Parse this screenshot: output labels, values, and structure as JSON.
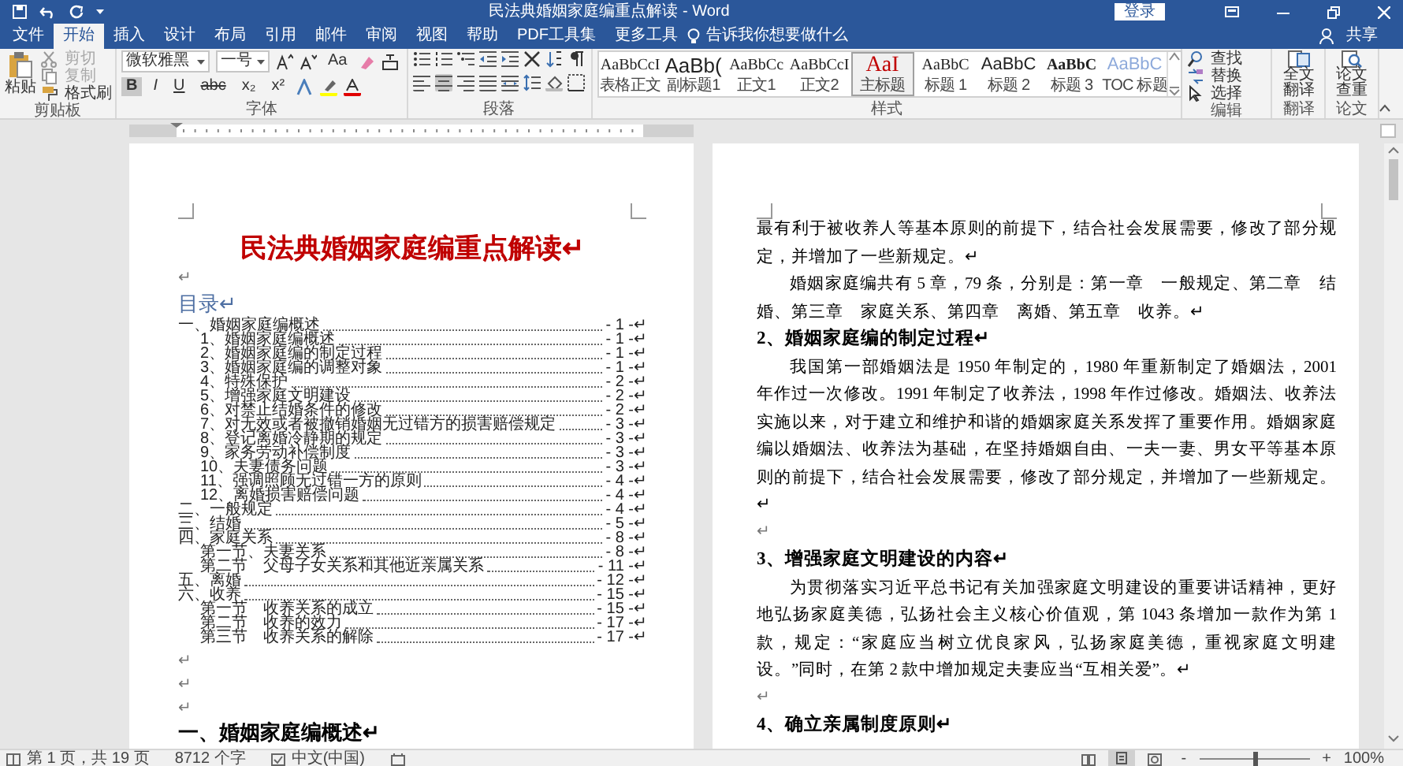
{
  "title_bar": {
    "title": "民法典婚姻家庭编重点解读 - Word",
    "sign_in": "登录"
  },
  "tabs": [
    {
      "label": "文件",
      "selected": false
    },
    {
      "label": "开始",
      "selected": true
    },
    {
      "label": "插入",
      "selected": false
    },
    {
      "label": "设计",
      "selected": false
    },
    {
      "label": "布局",
      "selected": false
    },
    {
      "label": "引用",
      "selected": false
    },
    {
      "label": "邮件",
      "selected": false
    },
    {
      "label": "审阅",
      "selected": false
    },
    {
      "label": "视图",
      "selected": false
    },
    {
      "label": "帮助",
      "selected": false
    },
    {
      "label": "PDF工具集",
      "selected": false
    },
    {
      "label": "更多工具",
      "selected": false
    }
  ],
  "tell_me": "告诉我你想要做什么",
  "share": "共享",
  "ribbon": {
    "clipboard": {
      "label": "剪贴板",
      "paste": "粘贴",
      "items": [
        {
          "label": "剪切",
          "disabled": true
        },
        {
          "label": "复制",
          "disabled": true
        },
        {
          "label": "格式刷",
          "disabled": false
        }
      ]
    },
    "font": {
      "label": "字体",
      "name": "微软雅黑",
      "size": "一号",
      "case_button": "Aa",
      "buttons": [
        {
          "text": "B",
          "selected": true
        },
        {
          "text": "I",
          "selected": false
        },
        {
          "text": "U",
          "selected": false
        },
        {
          "text": "abc",
          "selected": false
        },
        {
          "text": "x₂",
          "selected": false
        },
        {
          "text": "x²",
          "selected": false
        }
      ]
    },
    "paragraph": {
      "label": "段落",
      "align": [
        {
          "selected": false
        },
        {
          "selected": true
        },
        {
          "selected": false
        },
        {
          "selected": false
        },
        {
          "selected": false
        }
      ]
    },
    "styles": {
      "label": "样式",
      "items": [
        {
          "preview": "AaBbCcI",
          "name": "表格正文",
          "kind": "plain",
          "selected": false
        },
        {
          "preview": "AaBb(",
          "name": "副标题1",
          "kind": "large",
          "selected": false
        },
        {
          "preview": "AaBbCc",
          "name": "正文1",
          "kind": "serif",
          "selected": false
        },
        {
          "preview": "AaBbCcI",
          "name": "正文2",
          "kind": "plain",
          "selected": false
        },
        {
          "preview": "AaI",
          "name": "主标题",
          "kind": "red",
          "selected": true
        },
        {
          "preview": "AaBbC",
          "name": "标题 1",
          "kind": "serif",
          "selected": false
        },
        {
          "preview": "AaBbC",
          "name": "标题 2",
          "kind": "medium",
          "selected": false
        },
        {
          "preview": "AaBbC",
          "name": "标题 3",
          "kind": "bold",
          "selected": false
        },
        {
          "preview": "AaBbC",
          "name": "TOC 标题",
          "kind": "toc",
          "selected": false
        }
      ]
    },
    "editing": {
      "label": "编辑",
      "items": [
        "查找",
        "替换",
        "选择"
      ]
    },
    "translate": {
      "label": "翻译",
      "button": "全文翻译"
    },
    "paper": {
      "label": "论文",
      "button": "论文查重"
    }
  },
  "left_page": [
    {
      "kind": "title",
      "text": "民法典婚姻家庭编重点解读↵"
    },
    {
      "kind": "blank",
      "text": "↵"
    },
    {
      "kind": "toc_heading",
      "text": "目录↵"
    },
    {
      "kind": "toc",
      "entries": [
        {
          "text": "一、婚姻家庭编概述",
          "page": "- 1 -↵",
          "children": [
            {
              "text": "1、婚姻家庭编概述",
              "page": "- 1 -↵"
            },
            {
              "text": "2、婚姻家庭编的制定过程",
              "page": "- 1 -↵"
            },
            {
              "text": "3、婚姻家庭编的调整对象",
              "page": "- 1 -↵"
            },
            {
              "text": "4、特殊保护",
              "page": "- 2 -↵"
            },
            {
              "text": "5、增强家庭文明建设",
              "page": "- 2 -↵"
            },
            {
              "text": "6、对禁止结婚条件的修改",
              "page": "- 2 -↵"
            },
            {
              "text": "7、对无效或者被撤销婚姻无过错方的损害赔偿规定",
              "page": "- 3 -↵"
            },
            {
              "text": "8、登记离婚冷静期的规定",
              "page": "- 3 -↵"
            },
            {
              "text": "9、家务劳动补偿制度",
              "page": "- 3 -↵"
            },
            {
              "text": "10、夫妻债务问题",
              "page": "- 3 -↵"
            },
            {
              "text": "11、强调照顾无过错一方的原则",
              "page": "- 4 -↵"
            },
            {
              "text": "12、离婚损害赔偿问题",
              "page": "- 4 -↵"
            }
          ]
        },
        {
          "text": "二、一般规定",
          "page": "- 4 -↵"
        },
        {
          "text": "三、结婚",
          "page": "- 5 -↵"
        },
        {
          "text": "四、家庭关系",
          "page": "- 8 -↵",
          "children": [
            {
              "text": "第一节、夫妻关系",
              "page": "- 8 -↵"
            },
            {
              "text": "第二节　父母子女关系和其他近亲属关系",
              "page": "- 11 -↵"
            }
          ]
        },
        {
          "text": "五、离婚",
          "page": "- 12 -↵"
        },
        {
          "text": "六、收养",
          "page": "- 15 -↵",
          "children": [
            {
              "text": "第一节　收养关系的成立",
              "page": "- 15 -↵"
            },
            {
              "text": "第二节　收养的效力",
              "page": "- 17 -↵"
            },
            {
              "text": "第三节　收养关系的解除",
              "page": "- 17 -↵"
            }
          ]
        }
      ]
    },
    {
      "kind": "blank",
      "text": "↵"
    },
    {
      "kind": "blank",
      "text": "↵"
    },
    {
      "kind": "blank",
      "text": "↵"
    },
    {
      "kind": "heading1",
      "text": "一、婚姻家庭编概述↵"
    }
  ],
  "right_page": [
    {
      "kind": "para_cont",
      "text": "最有利于被收养人等基本原则的前提下，结合社会发展需要，修改了部分规定，并增加了一些新规定。↵"
    },
    {
      "kind": "para",
      "text": "婚姻家庭编共有 5 章，79 条，分别是：第一章　一般规定、第二章　结婚、第三章　家庭关系、第四章　离婚、第五章　收养。↵"
    },
    {
      "kind": "heading",
      "text": "2、婚姻家庭编的制定过程↵"
    },
    {
      "kind": "para",
      "text": "我国第一部婚姻法是 1950 年制定的，1980 年重新制定了婚姻法，2001 年作过一次修改。1991 年制定了收养法，1998 年作过修改。婚姻法、收养法实施以来，对于建立和维护和谐的婚姻家庭关系发挥了重要作用。婚姻家庭编以婚姻法、收养法为基础，在坚持婚姻自由、一夫一妻、男女平等基本原则的前提下，结合社会发展需要，修改了部分规定，并增加了一些新规定。↵"
    },
    {
      "kind": "blank",
      "text": "↵"
    },
    {
      "kind": "heading",
      "text": "3、增强家庭文明建设的内容↵"
    },
    {
      "kind": "para",
      "text": "为贯彻落实习近平总书记有关加强家庭文明建设的重要讲话精神，更好地弘扬家庭美德，弘扬社会主义核心价值观，第 1043 条增加一款作为第 1 款，规定：“家庭应当树立优良家风，弘扬家庭美德，重视家庭文明建设。”同时，在第 2 款中增加规定夫妻应当“互相关爱”。↵"
    },
    {
      "kind": "blank",
      "text": "↵"
    },
    {
      "kind": "heading",
      "text": "4、确立亲属制度原则↵"
    }
  ],
  "status_bar": {
    "page": "第 1 页，共 19 页",
    "words": "8712 个字",
    "language": "中文(中国)",
    "zoom_out": "-",
    "zoom_in": "+",
    "zoom": "100%",
    "zoom_slider": {
      "level": 0.5
    }
  }
}
